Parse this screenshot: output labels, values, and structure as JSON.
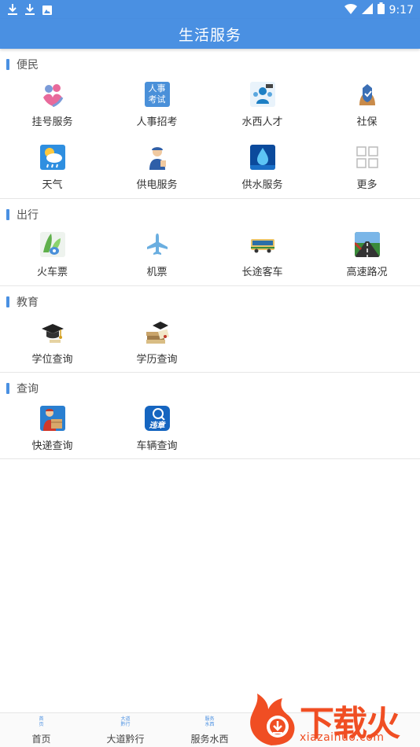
{
  "status_bar": {
    "time": "9:17"
  },
  "header": {
    "title": "生活服务"
  },
  "sections": [
    {
      "title": "便民",
      "items": [
        {
          "label": "挂号服务",
          "icon": "registration-icon"
        },
        {
          "label": "人事招考",
          "icon": "personnel-exam-icon",
          "icon_text": [
            "人事",
            "考试"
          ]
        },
        {
          "label": "水西人才",
          "icon": "talent-icon"
        },
        {
          "label": "社保",
          "icon": "social-security-icon"
        },
        {
          "label": "天气",
          "icon": "weather-icon"
        },
        {
          "label": "供电服务",
          "icon": "electricity-icon"
        },
        {
          "label": "供水服务",
          "icon": "water-supply-icon"
        },
        {
          "label": "更多",
          "icon": "more-grid-icon"
        }
      ]
    },
    {
      "title": "出行",
      "items": [
        {
          "label": "火车票",
          "icon": "train-ticket-icon"
        },
        {
          "label": "机票",
          "icon": "airplane-icon"
        },
        {
          "label": "长途客车",
          "icon": "bus-icon"
        },
        {
          "label": "高速路况",
          "icon": "highway-icon"
        }
      ]
    },
    {
      "title": "教育",
      "items": [
        {
          "label": "学位查询",
          "icon": "graduation-cap-icon"
        },
        {
          "label": "学历查询",
          "icon": "diploma-books-icon"
        }
      ]
    },
    {
      "title": "查询",
      "items": [
        {
          "label": "快递查询",
          "icon": "courier-icon"
        },
        {
          "label": "车辆查询",
          "icon": "vehicle-violation-icon",
          "icon_text": "违章"
        }
      ]
    }
  ],
  "tabbar": {
    "tabs": [
      {
        "label": "首页",
        "icon_text": [
          "首",
          "页"
        ]
      },
      {
        "label": "大道黔行",
        "icon_text": [
          "大道",
          "黔行"
        ]
      },
      {
        "label": "服务水西",
        "icon_text": [
          "服务",
          "水西"
        ]
      }
    ]
  },
  "watermark": {
    "text": "下载火",
    "url": "xiazaihuo.com"
  },
  "colors": {
    "primary": "#4a90e2",
    "watermark": "#f04e23"
  }
}
